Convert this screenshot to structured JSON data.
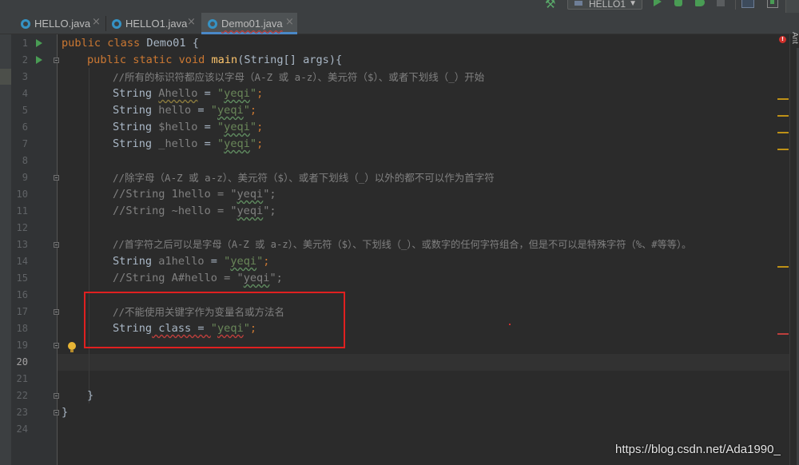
{
  "toolbar": {
    "run_config": "HELLO1",
    "icons": [
      "build-hammer-icon",
      "run-icon",
      "debug-icon",
      "coverage-icon",
      "stop-icon",
      "structure-icon",
      "project-icon"
    ]
  },
  "tabs": [
    {
      "label": "HELLO.java",
      "active": false
    },
    {
      "label": "HELLO1.java",
      "active": false
    },
    {
      "label": "Demo01.java",
      "active": true
    }
  ],
  "editor": {
    "current_line": 20,
    "line_numbers": [
      "1",
      "2",
      "3",
      "4",
      "5",
      "6",
      "7",
      "8",
      "9",
      "10",
      "11",
      "12",
      "13",
      "14",
      "15",
      "16",
      "17",
      "18",
      "19",
      "20",
      "21",
      "22",
      "23",
      "24"
    ],
    "code": {
      "l1": {
        "kw": "public class ",
        "rest": "Demo01 {"
      },
      "l2": {
        "kw": "public static void ",
        "fn": "main",
        "rest": "(String[] args){"
      },
      "l3": {
        "comment": "//所有的标识符都应该以字母（A-Z 或 a-z）、美元符（$）、或者下划线（_）开始"
      },
      "l4": {
        "type": "String ",
        "var": "Ahello",
        "eq": " = ",
        "str_open": "\"",
        "str": "yeqi",
        "str_close": "\"",
        "end": ";"
      },
      "l5": {
        "type": "String ",
        "var": "hello",
        "eq": " = ",
        "str_open": "\"",
        "str": "yeqi",
        "str_close": "\"",
        "end": ";"
      },
      "l6": {
        "type": "String ",
        "var": "$hello",
        "eq": " = ",
        "str_open": "\"",
        "str": "yeqi",
        "str_close": "\"",
        "end": ";"
      },
      "l7": {
        "type": "String ",
        "var": "_hello",
        "eq": " = ",
        "str_open": "\"",
        "str": "yeqi",
        "str_close": "\"",
        "end": ";"
      },
      "l9": {
        "comment": "//除字母（A-Z 或 a-z）、美元符（$）、或者下划线（_）以外的都不可以作为首字符"
      },
      "l10": {
        "comment_a": "//String 1hello = \"",
        "comment_typo": "yeqi",
        "comment_b": "\";"
      },
      "l11": {
        "comment_a": "//String ~hello = \"",
        "comment_typo": "yeqi",
        "comment_b": "\";"
      },
      "l13": {
        "comment": "//首字符之后可以是字母（A-Z 或 a-z）、美元符（$）、下划线（_）、或数字的任何字符组合，但是不可以是特殊字符（%、#等等）。"
      },
      "l14": {
        "type": "String ",
        "var": "a1hello",
        "eq": " = ",
        "str_open": "\"",
        "str": "yeqi",
        "str_close": "\"",
        "end": ";"
      },
      "l15": {
        "comment_a": "//String A#hello = \"",
        "comment_typo": "yeqi",
        "comment_b": "\";"
      },
      "l17": {
        "comment": "//不能使用关键字作为变量名或方法名"
      },
      "l18": {
        "type": "String",
        "err": " class = ",
        "str_open": "\"",
        "str": "yeqi",
        "str_close": "\"",
        "end": ";"
      },
      "l22": {
        "rest": "}"
      },
      "l23": {
        "rest": "}"
      }
    }
  },
  "side_panel": {
    "label": "Ant"
  },
  "watermark": "https://blog.csdn.net/Ada1990_",
  "colors": {
    "keyword": "#cc7832",
    "method": "#ffc66d",
    "string": "#6a8759",
    "comment": "#808080",
    "text": "#a9b7c6",
    "error": "#bc3f3c",
    "warning": "#be9117",
    "highlight_box": "#e02020"
  }
}
